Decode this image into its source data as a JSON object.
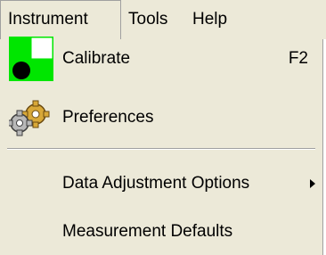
{
  "menubar": {
    "items": [
      {
        "label": "Instrument"
      },
      {
        "label": "Tools"
      },
      {
        "label": "Help"
      }
    ]
  },
  "menu": {
    "calibrate": {
      "label": "Calibrate",
      "shortcut": "F2",
      "icon": "calibrate-icon"
    },
    "preferences": {
      "label": "Preferences",
      "icon": "gears-icon"
    },
    "data_adjustment": {
      "label": "Data Adjustment Options"
    },
    "measurement_defaults": {
      "label": "Measurement Defaults"
    }
  },
  "colors": {
    "menu_bg": "#ece9d8",
    "calibrate_green": "#00e600",
    "separator": "#a0a0a0"
  }
}
